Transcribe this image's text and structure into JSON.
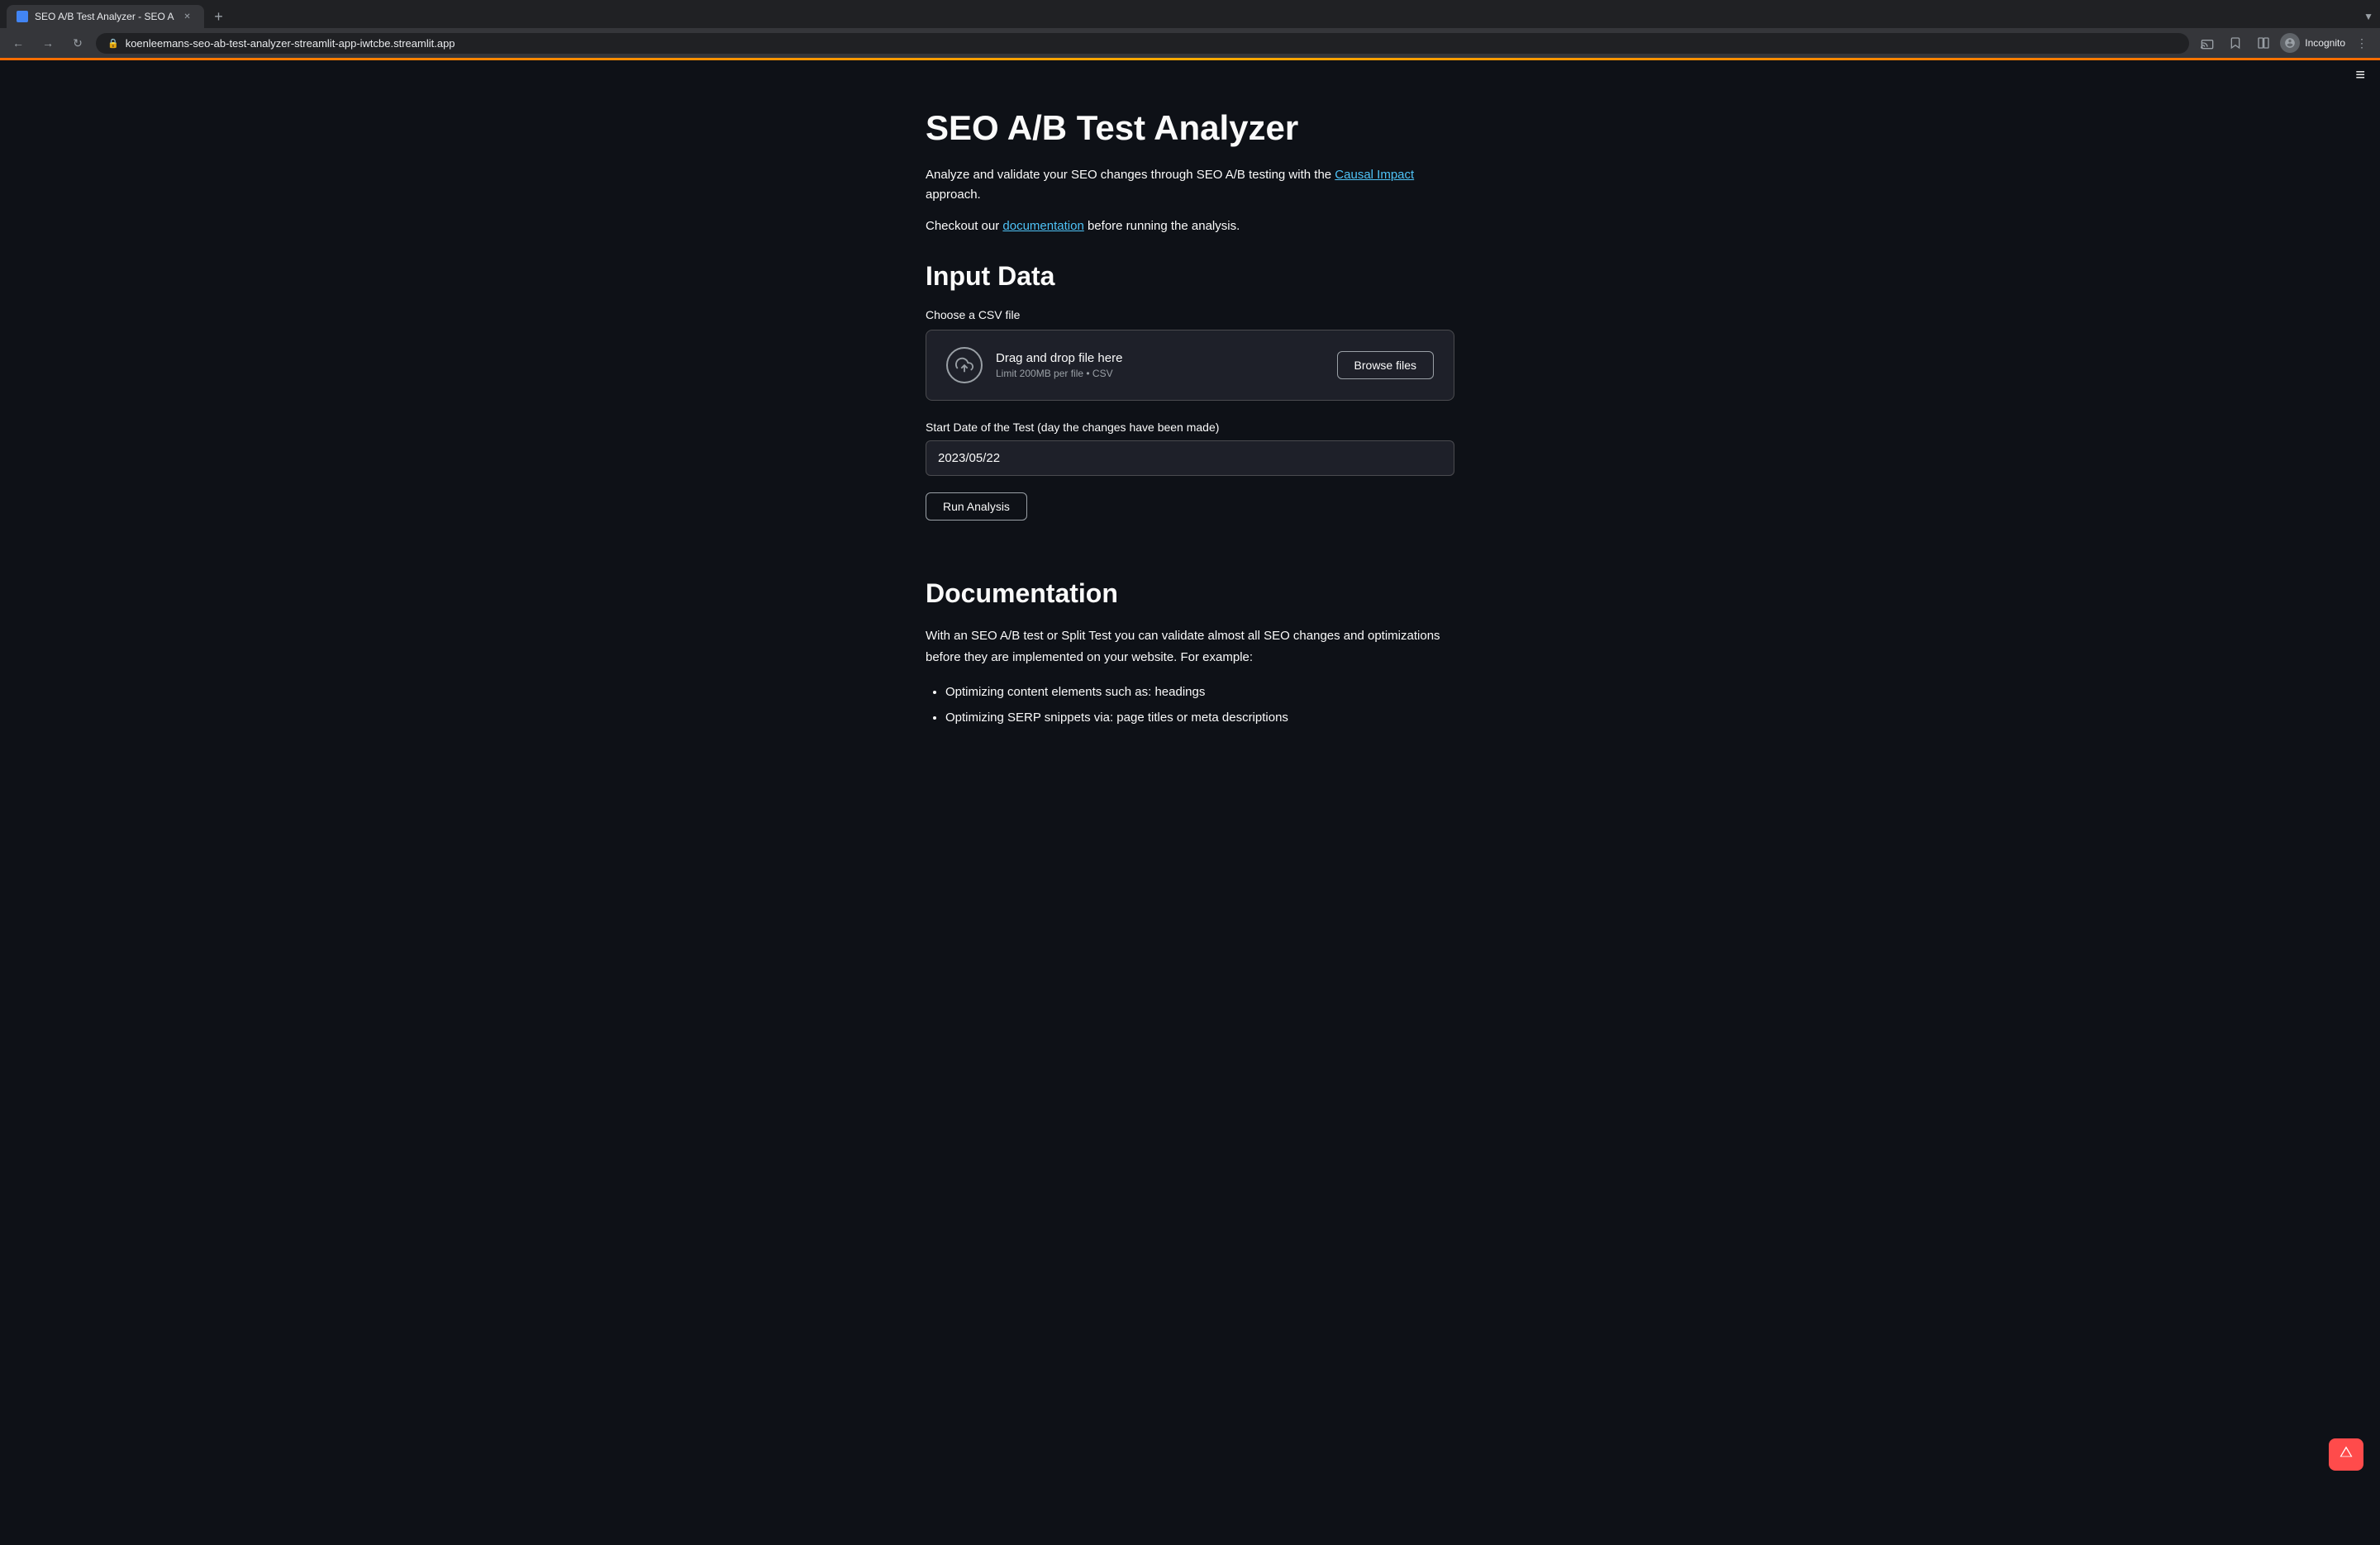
{
  "browser": {
    "tab_label": "SEO A/B Test Analyzer - SEO A",
    "url": "koenleemans-seo-ab-test-analyzer-streamlit-app-iwtcbe.streamlit.app",
    "incognito_label": "Incognito"
  },
  "page": {
    "title": "SEO A/B Test Analyzer",
    "description_before_link": "Analyze and validate your SEO changes through SEO A/B testing with the ",
    "causal_impact_link": "Causal Impact",
    "description_after_link": " approach.",
    "checkout_before_link": "Checkout our ",
    "documentation_link": "documentation",
    "checkout_after_link": " before running the analysis."
  },
  "input_section": {
    "heading": "Input Data",
    "file_label": "Choose a CSV file",
    "drag_drop_text": "Drag and drop file here",
    "limit_text": "Limit 200MB per file • CSV",
    "browse_button": "Browse files",
    "date_label": "Start Date of the Test (day the changes have been made)",
    "date_value": "2023/05/22",
    "run_button": "Run Analysis"
  },
  "documentation_section": {
    "heading": "Documentation",
    "paragraph": "With an SEO A/B test or Split Test you can validate almost all SEO changes and optimizations before they are implemented on your website. For example:",
    "bullets": [
      "Optimizing content elements such as: headings",
      "Optimizing SERP snippets via: page titles or meta descriptions"
    ]
  }
}
